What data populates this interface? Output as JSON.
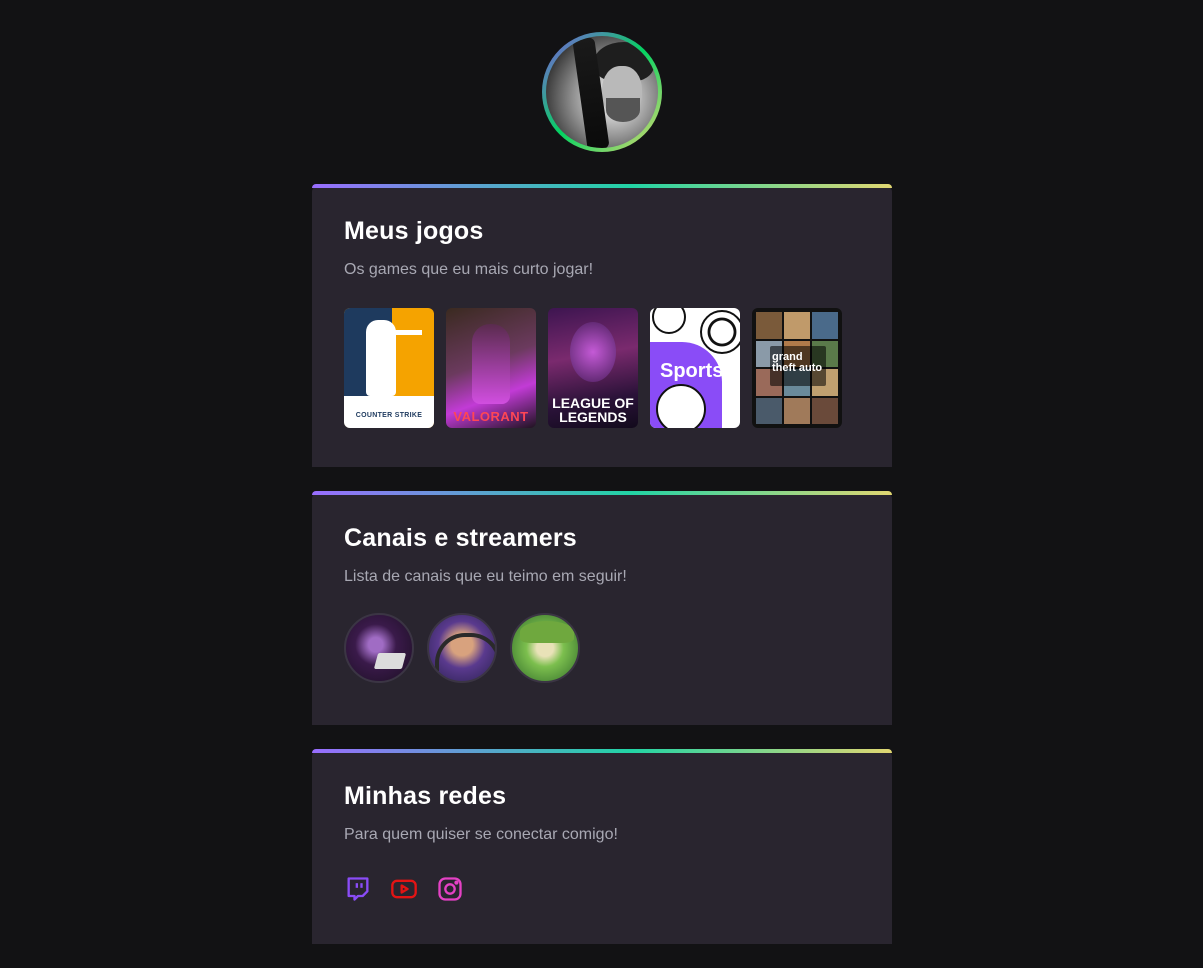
{
  "profile": {
    "avatar_icon": "profile-photo-guitar"
  },
  "games_card": {
    "title": "Meus jogos",
    "subtitle": "Os games que eu mais curto jogar!",
    "games": [
      {
        "name": "Counter-Strike",
        "label": "COUNTER STRIKE",
        "icon": "counter-strike-cover"
      },
      {
        "name": "Valorant",
        "label": "VALORANT",
        "icon": "valorant-cover"
      },
      {
        "name": "League of Legends",
        "label": "LEAGUE OF LEGENDS",
        "icon": "league-of-legends-cover"
      },
      {
        "name": "Sports",
        "label": "Sports",
        "icon": "sports-cover"
      },
      {
        "name": "Grand Theft Auto V",
        "label": "grand theft auto",
        "icon": "gta-v-cover"
      }
    ]
  },
  "streamers_card": {
    "title": "Canais e streamers",
    "subtitle": "Lista de canais que eu teimo em seguir!",
    "streamers": [
      {
        "icon": "streamer-avatar-1"
      },
      {
        "icon": "streamer-avatar-2"
      },
      {
        "icon": "streamer-avatar-3"
      }
    ]
  },
  "social_card": {
    "title": "Minhas redes",
    "subtitle": "Para quem quiser se conectar comigo!",
    "links": [
      {
        "name": "Twitch",
        "icon": "twitch-icon",
        "color": "#8A4CF7"
      },
      {
        "name": "YouTube",
        "icon": "youtube-icon",
        "color": "#E31414"
      },
      {
        "name": "Instagram",
        "icon": "instagram-icon",
        "color": "#E541C5"
      }
    ]
  },
  "colors": {
    "background": "#121214",
    "card": "#29252F",
    "gradient": [
      "#996DFF",
      "#22D4A5",
      "#E1D772"
    ],
    "title": "#FFFFFF",
    "subtitle": "#A8A8B3"
  }
}
